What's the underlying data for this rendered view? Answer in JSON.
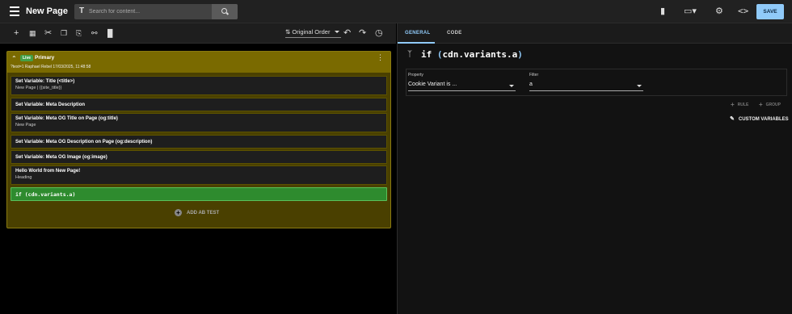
{
  "header": {
    "app_title": "New Page",
    "search_placeholder": "Search for content...",
    "search_type_icon": "T",
    "save_label": "SAVE"
  },
  "toolbar": {
    "order_label": "Original Order"
  },
  "variant": {
    "live_badge": "Live",
    "label": "Primary",
    "meta": "?test=1 Raphael Rebel 17/03/2025, 11:48:58",
    "items": [
      {
        "title": "Set Variable: Title (<title>)",
        "subtitle": "New Page | {{site_title}}"
      },
      {
        "title": "Set Variable: Meta Description",
        "subtitle": ""
      },
      {
        "title": "Set Variable: Meta OG Title on Page (og:title)",
        "subtitle": "New Page"
      },
      {
        "title": "Set Variable: Meta OG Description on Page (og:description)",
        "subtitle": ""
      },
      {
        "title": "Set Variable: Meta OG Image (og:image)",
        "subtitle": ""
      },
      {
        "title": "Hello World from New Page!",
        "subtitle": "Heading"
      }
    ],
    "if_item": "if (cdn.variants.a)",
    "add_ab_test": "ADD AB TEST"
  },
  "panel": {
    "tabs": [
      "GENERAL",
      "CODE"
    ],
    "condition": {
      "kw": "if ",
      "open": "(",
      "var": "cdn.variants.a",
      "close": ")"
    },
    "property_label": "Property",
    "property_value": "Cookie Variant is ...",
    "filter_label": "Filter",
    "filter_value": "a",
    "rule_label": "RULE",
    "group_label": "GROUP",
    "custom_variables_label": "CUSTOM VARIABLES"
  },
  "colors": {
    "accent": "#90caf9",
    "variant_bg": "#4a4000",
    "variant_head": "#7a6a00",
    "if_green": "#2e8b2e",
    "live_green": "#43a047"
  }
}
